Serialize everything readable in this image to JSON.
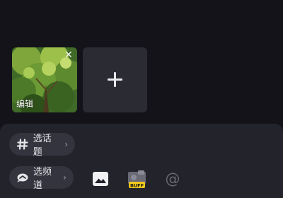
{
  "media": {
    "thumbnail": {
      "close_icon": "close-icon",
      "edit_label": "编辑"
    },
    "add_tile": {
      "icon": "plus-icon"
    }
  },
  "toolbar": {
    "topic_button": {
      "icon": "hashtag-icon",
      "label": "选话题",
      "chevron": "›"
    },
    "channel_button": {
      "icon": "channel-icon",
      "label": "选频道",
      "chevron": "›"
    },
    "tools": [
      "image-icon",
      "buff-icon",
      "at-icon"
    ],
    "at_glyph": "@",
    "buff_text": "BUFF"
  },
  "colors": {
    "background": "#131319",
    "panel": "#23232c",
    "pill": "#34343f",
    "tile": "#2b2b34"
  }
}
